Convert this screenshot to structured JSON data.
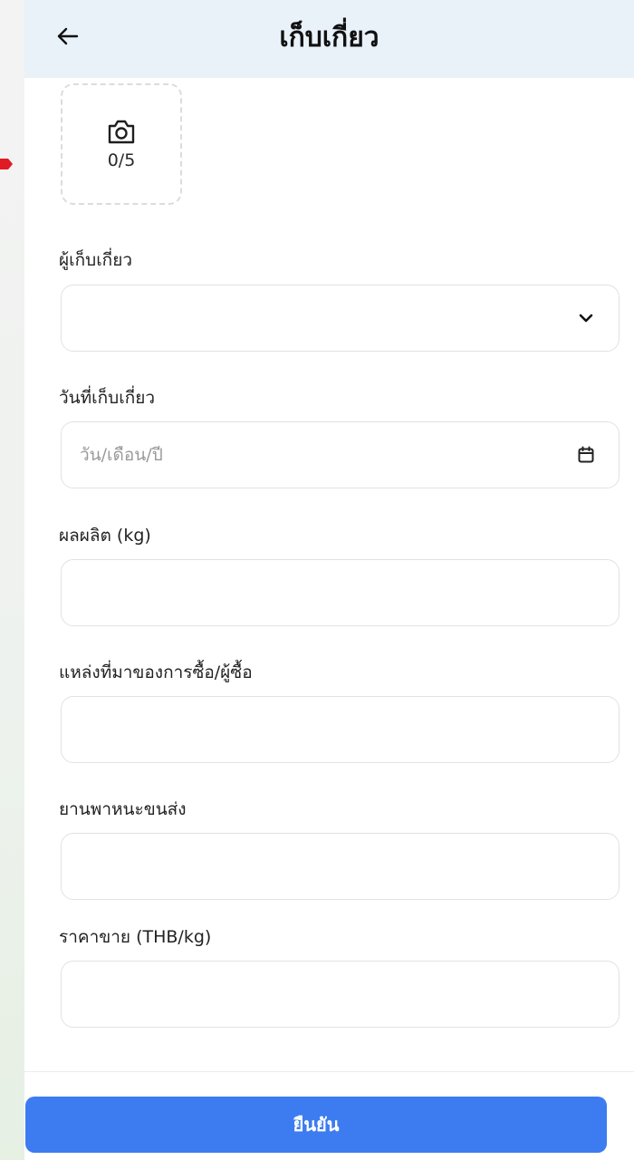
{
  "header": {
    "title": "เก็บเกี่ยว",
    "back_icon": "arrow-left-icon"
  },
  "photo_upload": {
    "icon": "camera-icon",
    "count": "0/5"
  },
  "form": {
    "harvester": {
      "label": "ผู้เก็บเกี่ยว",
      "value": "",
      "icon": "chevron-down-icon"
    },
    "harvest_date": {
      "label": "วันที่เก็บเกี่ยว",
      "placeholder": "วัน/เดือน/ปี",
      "value": "",
      "icon": "calendar-icon"
    },
    "yield": {
      "label": "ผลผลิต (kg)",
      "value": ""
    },
    "buyer_source": {
      "label": "แหล่งที่มาของการซื้อ/ผู้ซื้อ",
      "value": ""
    },
    "vehicle": {
      "label": "ยานพาหนะขนส่ง",
      "value": ""
    },
    "sale_price": {
      "label": "ราคาขาย (THB/kg)",
      "value": ""
    }
  },
  "footer": {
    "confirm_label": "ยืนยัน"
  },
  "colors": {
    "app_bar": "#e9f1f9",
    "primary_button": "#3d7cf0",
    "annotation_arrow": "#e01b24"
  }
}
